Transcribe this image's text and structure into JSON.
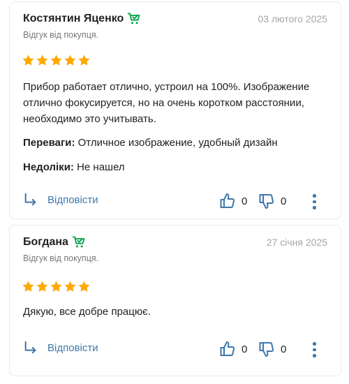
{
  "reviews": [
    {
      "author": "Костянтин Яценко",
      "date": "03 лютого 2025",
      "purchase_note": "Відгук від покупця.",
      "rating": 5,
      "text": "Прибор работает отлично, устроил на 100%. Изображение отлично фокусируется, но на очень коротком расстоянии, необходимо это учитывать.",
      "pros_label": "Переваги:",
      "pros": "Отличное изображение, удобный дизайн",
      "cons_label": "Недоліки:",
      "cons": "Не нашел",
      "reply_label": "Відповісти",
      "likes": "0",
      "dislikes": "0"
    },
    {
      "author": "Богдана",
      "date": "27 січня 2025",
      "purchase_note": "Відгук від покупця.",
      "rating": 5,
      "text": "Дякую, все добре працює.",
      "reply_label": "Відповісти",
      "likes": "0",
      "dislikes": "0"
    }
  ],
  "icons": {
    "verified": "cart-check-icon",
    "star": "star-icon",
    "reply": "reply-arrow-icon",
    "like": "thumbs-up-icon",
    "dislike": "thumbs-down-icon",
    "more": "more-vertical-icon"
  },
  "colors": {
    "star": "#ffa900",
    "verified": "#00a046",
    "link": "#3e77aa",
    "muted": "#a6a5a5"
  }
}
